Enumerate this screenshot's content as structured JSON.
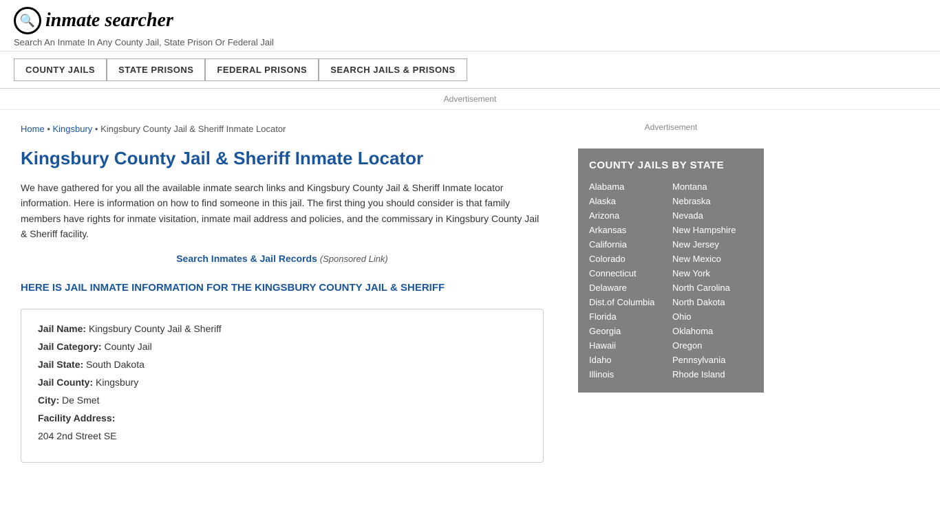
{
  "header": {
    "logo_icon": "🔍",
    "logo_text": "inmate searcher",
    "tagline": "Search An Inmate In Any County Jail, State Prison Or Federal Jail"
  },
  "nav": {
    "items": [
      {
        "label": "COUNTY JAILS",
        "active": true
      },
      {
        "label": "STATE PRISONS",
        "active": false
      },
      {
        "label": "FEDERAL PRISONS",
        "active": false
      },
      {
        "label": "SEARCH JAILS & PRISONS",
        "active": false
      }
    ]
  },
  "ad_label": "Advertisement",
  "breadcrumb": {
    "home": "Home",
    "parent": "Kingsbury",
    "current": "Kingsbury County Jail & Sheriff Inmate Locator"
  },
  "page_title": "Kingsbury County Jail & Sheriff Inmate Locator",
  "description": "We have gathered for you all the available inmate search links and Kingsbury County Jail & Sheriff Inmate locator information. Here is information on how to find someone in this jail. The first thing you should consider is that family members have rights for inmate visitation, inmate mail address and policies, and the commissary in Kingsbury County Jail & Sheriff facility.",
  "search_link": {
    "text": "Search Inmates & Jail Records",
    "suffix": "(Sponsored Link)"
  },
  "section_heading": "HERE IS JAIL INMATE INFORMATION FOR THE KINGSBURY COUNTY JAIL & SHERIFF",
  "jail_info": {
    "name_label": "Jail Name:",
    "name_value": "Kingsbury County Jail & Sheriff",
    "category_label": "Jail Category:",
    "category_value": "County Jail",
    "state_label": "Jail State:",
    "state_value": "South Dakota",
    "county_label": "Jail County:",
    "county_value": "Kingsbury",
    "city_label": "City:",
    "city_value": "De Smet",
    "address_label": "Facility Address:",
    "address_value": "204 2nd Street SE"
  },
  "sidebar": {
    "ad_label": "Advertisement",
    "state_list_title": "COUNTY JAILS BY STATE",
    "states_left": [
      "Alabama",
      "Alaska",
      "Arizona",
      "Arkansas",
      "California",
      "Colorado",
      "Connecticut",
      "Delaware",
      "Dist.of Columbia",
      "Florida",
      "Georgia",
      "Hawaii",
      "Idaho",
      "Illinois"
    ],
    "states_right": [
      "Montana",
      "Nebraska",
      "Nevada",
      "New Hampshire",
      "New Jersey",
      "New Mexico",
      "New York",
      "North Carolina",
      "North Dakota",
      "Ohio",
      "Oklahoma",
      "Oregon",
      "Pennsylvania",
      "Rhode Island"
    ]
  }
}
